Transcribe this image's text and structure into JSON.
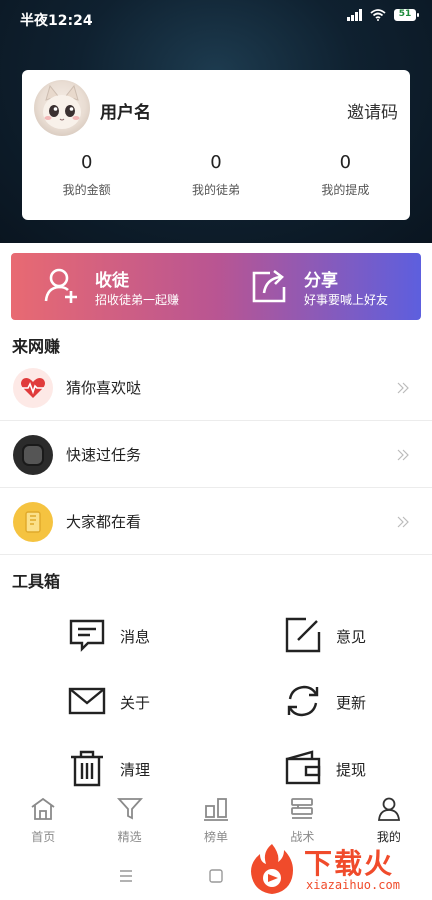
{
  "status_bar": {
    "time": "半夜12:24",
    "battery": "51"
  },
  "profile": {
    "username": "用户名",
    "invite_label": "邀请码",
    "stats": [
      {
        "value": "0",
        "label": "我的金额"
      },
      {
        "value": "0",
        "label": "我的徒弟"
      },
      {
        "value": "0",
        "label": "我的提成"
      }
    ]
  },
  "banner": {
    "left": {
      "title": "收徒",
      "subtitle": "招收徒弟一起赚",
      "icon": "add-user-icon"
    },
    "right": {
      "title": "分享",
      "subtitle": "好事要喊上好友",
      "icon": "share-icon"
    }
  },
  "earn_section": {
    "title": "来网赚",
    "items": [
      {
        "label": "猜你喜欢哒",
        "icon": "heartbeat-icon"
      },
      {
        "label": "快速过任务",
        "icon": "task-icon"
      },
      {
        "label": "大家都在看",
        "icon": "notebook-icon"
      }
    ]
  },
  "toolbox": {
    "title": "工具箱",
    "items": [
      {
        "label": "消息",
        "icon": "message-icon"
      },
      {
        "label": "意见",
        "icon": "feedback-icon"
      },
      {
        "label": "关于",
        "icon": "mail-icon"
      },
      {
        "label": "更新",
        "icon": "refresh-icon"
      },
      {
        "label": "清理",
        "icon": "trash-icon"
      },
      {
        "label": "提现",
        "icon": "wallet-icon"
      }
    ]
  },
  "tabbar": {
    "tabs": [
      {
        "label": "首页",
        "icon": "home-icon"
      },
      {
        "label": "精选",
        "icon": "filter-icon"
      },
      {
        "label": "榜单",
        "icon": "ranking-icon"
      },
      {
        "label": "战术",
        "icon": "tactics-icon"
      },
      {
        "label": "我的",
        "icon": "profile-icon"
      }
    ],
    "active_index": 4
  },
  "watermark": {
    "text": "下载火",
    "url": "xiazaihuo.com"
  },
  "colors": {
    "header_bg": "#0f2130",
    "banner_start": "#e86a72",
    "banner_end": "#5d5fde",
    "heart_red": "#e03b3b",
    "note_yellow": "#f5c340",
    "watermark": "#f04b2b"
  }
}
